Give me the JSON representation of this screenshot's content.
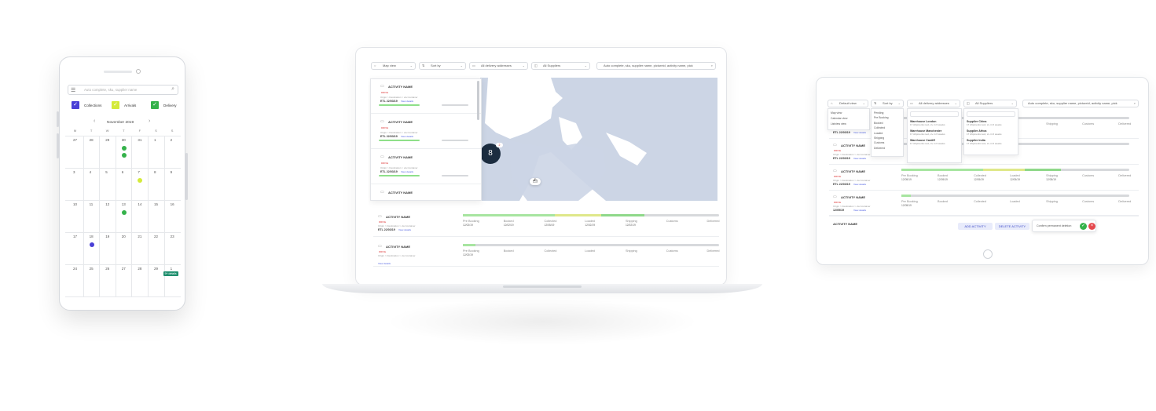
{
  "colors": {
    "collections": "#4a3fd6",
    "arrivals": "#d4ea3a",
    "delivery": "#35b24b",
    "progress_green": "#8fe08a",
    "progress_yellow": "#dfe88a",
    "ocean": "#ffffff",
    "land": "#ccd5e5",
    "cluster": "#1c2d40"
  },
  "phone": {
    "search_placeholder": "Auto complete, sku, supplier name",
    "filters": [
      {
        "label": "Collections",
        "color": "#4a3fd6"
      },
      {
        "label": "Arrivals",
        "color": "#d4ea3a"
      },
      {
        "label": "Delivery",
        "color": "#35b24b"
      }
    ],
    "month": "November 2019",
    "weekdays": [
      "M",
      "T",
      "W",
      "T",
      "F",
      "S",
      "S"
    ],
    "weeks": [
      [
        "27",
        "28",
        "29",
        "30",
        "31",
        "1",
        "2"
      ],
      [
        "3",
        "4",
        "5",
        "6",
        "7",
        "8",
        "9"
      ],
      [
        "10",
        "11",
        "12",
        "13",
        "14",
        "15",
        "16"
      ],
      [
        "17",
        "18",
        "19",
        "20",
        "21",
        "22",
        "23"
      ],
      [
        "24",
        "25",
        "26",
        "27",
        "28",
        "29",
        "1"
      ]
    ],
    "event_tag": "9+ details"
  },
  "laptop": {
    "view": "Map view",
    "sort": "Sort by",
    "addresses": "All delivery addresses",
    "suppliers": "All Suppliers",
    "search_placeholder": "Auto complete, sku, supplier name, pictureid, activity name, pick",
    "cluster_count": "8",
    "cluster_badge": "2",
    "list": [
      {
        "name": "ACTIVITY NAME",
        "status": "DRIVE",
        "route": "Origin > Destination > via Container",
        "eta": "ETL 22/03/19",
        "link": "View details"
      },
      {
        "name": "ACTIVITY NAME",
        "status": "DRIVE",
        "route": "Origin > Destination > via Container",
        "eta": "ETL 22/03/19",
        "link": "View details"
      },
      {
        "name": "ACTIVITY NAME",
        "status": "DRIVE",
        "route": "Origin > Destination > via Container",
        "eta": "ETL 22/03/19",
        "link": "View details"
      },
      {
        "name": "ACTIVITY NAME",
        "status": "",
        "route": "",
        "eta": "",
        "link": ""
      }
    ],
    "rows": [
      {
        "name": "ACTIVITY NAME",
        "status": "DRIVE",
        "route": "Origin > Destination > via Container",
        "eta": "ETL 22/03/19",
        "link": "View details",
        "stages": [
          "Pre Booking",
          "Booked",
          "Collected",
          "Loaded",
          "Shipping",
          "Customs",
          "Delivered"
        ],
        "dates": [
          "12/02/19",
          "12/02/19",
          "12/05/19",
          "12/02/19",
          "12/02/19",
          "",
          ""
        ],
        "progress": 0.71
      },
      {
        "name": "ACTIVITY NAME",
        "status": "DRIVE",
        "route": "Origin > Destination > via Container",
        "eta": "",
        "link": "View details",
        "stages": [
          "Pre Booking",
          "Booked",
          "Collected",
          "Loaded",
          "Shipping",
          "Customs",
          "Delivered"
        ],
        "dates": [
          "12/02/19",
          "",
          "",
          "",
          "",
          "",
          ""
        ],
        "progress": 0.05
      }
    ]
  },
  "tablet": {
    "view": "Default view",
    "sort": "Sort by",
    "addresses": "All delivery addresses",
    "suppliers": "All Suppliers",
    "search_placeholder": "Auto complete, sku, supplier name, pictureid, activity name, pick",
    "view_options": [
      "Map view",
      "Calendar view",
      "Listview view"
    ],
    "sort_options": [
      "Pending",
      "Pre Booking",
      "Booked",
      "Collected",
      "Loaded",
      "Shipping",
      "Customs",
      "Delivered"
    ],
    "warehouses": [
      {
        "name": "Warehouse London",
        "sub": "17 shipments next, 2+ in 6 weeks"
      },
      {
        "name": "Warehouse Manchester",
        "sub": "17 shipments next, 2+ in 6 weeks"
      },
      {
        "name": "Warehouse Cardiff",
        "sub": "17 shipments next, 2+ in 6 weeks"
      }
    ],
    "suppliers_list": [
      {
        "name": "Supplier China",
        "sub": "17 shipments next, 2+ in 6 weeks"
      },
      {
        "name": "Supplier Africa",
        "sub": "17 shipments next, 2+ in 6 weeks"
      },
      {
        "name": "Supplier India",
        "sub": "17 shipments next, 2+ in 6 weeks"
      }
    ],
    "rows": [
      {
        "name": "ACTIVITY NAME",
        "status": "DRIVE",
        "route": "Origin > Destination > via Container",
        "eta": "ETL 22/03/19",
        "link": "View details",
        "progress": 0.0,
        "stages": [
          "",
          "",
          "",
          "",
          "Shipping",
          "Customs",
          "Delivered"
        ],
        "dates": [
          "",
          "",
          "",
          "",
          "",
          "",
          ""
        ]
      },
      {
        "name": "ACTIVITY NAME",
        "status": "DRIVE",
        "route": "Origin > Destination > via Container",
        "eta": "ETL 22/03/19",
        "link": "View details",
        "progress": 0.0,
        "stages": [
          "",
          "",
          "",
          "",
          "",
          "",
          ""
        ],
        "dates": [
          "",
          "",
          "",
          "",
          "",
          "",
          ""
        ]
      },
      {
        "name": "ACTIVITY NAME",
        "status": "DRIVE",
        "route": "Origin > Destination > via Container",
        "eta": "ETL 22/03/19",
        "link": "View details",
        "progress": 0.7,
        "stages": [
          "Pre Booking",
          "Booked",
          "Collected",
          "Loaded",
          "Shipping",
          "Customs",
          "Delivered"
        ],
        "dates": [
          "12/05/19",
          "12/05/19",
          "12/05/19",
          "12/05/19",
          "12/05/19",
          "",
          ""
        ]
      },
      {
        "name": "ACTIVITY NAME",
        "status": "DRIVE",
        "route": "Origin > Destination > via Container",
        "eta": "12/05/19",
        "link": "View details",
        "progress": 0.04,
        "stages": [
          "Pre Booking",
          "Booked",
          "Collected",
          "Loaded",
          "Shipping",
          "Customs",
          "Delivered"
        ],
        "dates": [
          "12/05/19",
          "",
          "",
          "",
          "",
          "",
          ""
        ]
      }
    ],
    "new_activity": "ACTIVITY NAME",
    "add_button": "ADD ACTIVITY",
    "delete_button": "DELETE ACTIVITY",
    "confirm_text": "Confirm permanent deletion"
  }
}
